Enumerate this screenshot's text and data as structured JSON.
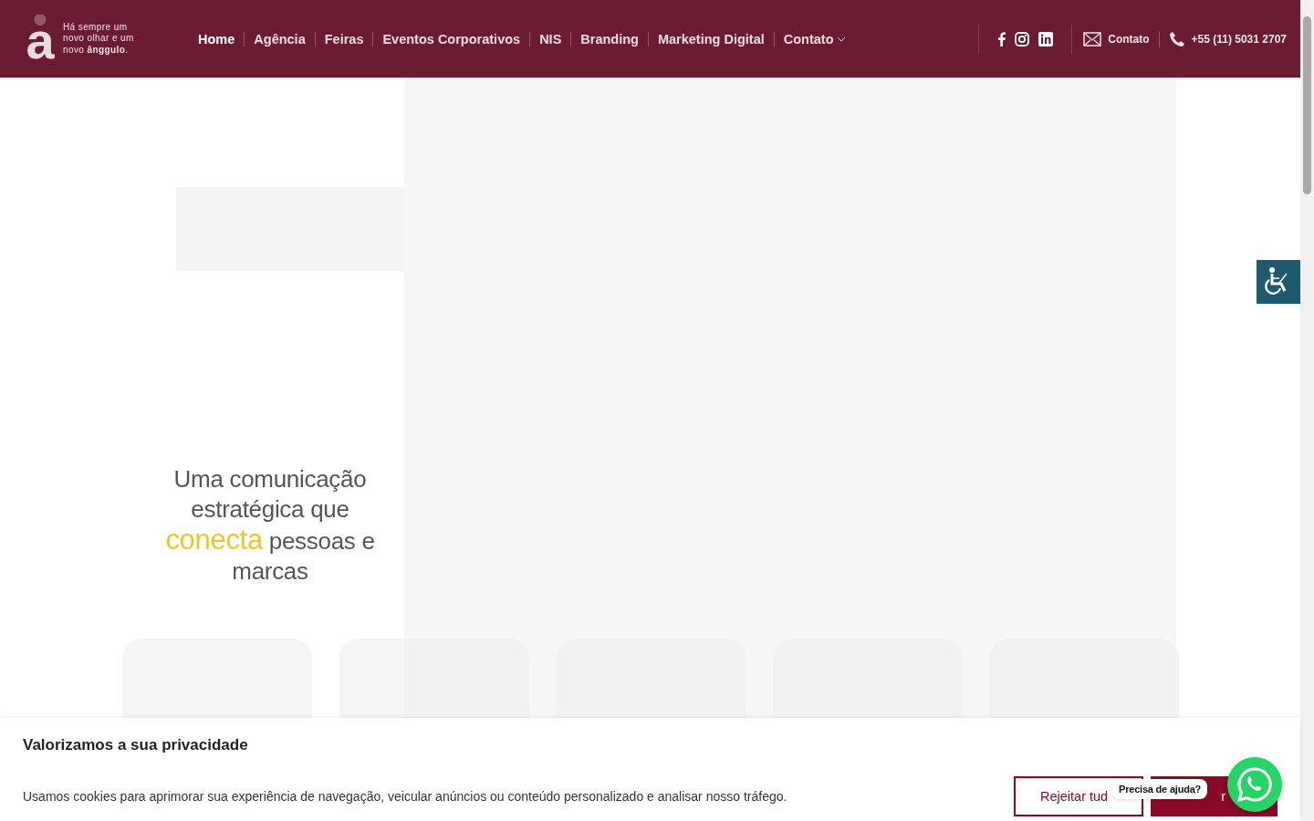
{
  "header": {
    "logo_mark": "a",
    "tagline": [
      "Há sempre um",
      "novo olhar e um",
      "novo **ânggulo**."
    ],
    "nav": [
      {
        "label": "Home",
        "selected": true,
        "dropdown": false
      },
      {
        "label": "Agência",
        "selected": false,
        "dropdown": false
      },
      {
        "label": "Feiras",
        "selected": false,
        "dropdown": false
      },
      {
        "label": "Eventos Corporativos",
        "selected": false,
        "dropdown": false
      },
      {
        "label": "NIS",
        "selected": false,
        "dropdown": false
      },
      {
        "label": "Branding",
        "selected": false,
        "dropdown": false
      },
      {
        "label": "Marketing Digital",
        "selected": false,
        "dropdown": false
      },
      {
        "label": "Contato",
        "selected": false,
        "dropdown": true
      }
    ],
    "contact_label": "Contato",
    "phone": "+55 (11) 5031 2707"
  },
  "hero": {
    "headline_before": "Uma comunicação estratégica que",
    "highlight": "conecta",
    "headline_after": "pessoas e marcas"
  },
  "cards": [
    {
      "kind": "placeholder"
    },
    {
      "kind": "placeholder"
    },
    {
      "kind": "placeholder"
    },
    {
      "kind": "placeholder"
    },
    {
      "kind": "placeholder"
    }
  ],
  "cookie_banner": {
    "title": "Valorizamos a sua privacidade",
    "text": "Usamos cookies para aprimorar sua experiência de navegação, veicular anúncios ou conteúdo personalizado e analisar nosso tráfego.",
    "reject_label": "Rejeitar tud",
    "accept_label": "r"
  },
  "chat": {
    "tooltip": "Precisa de ajuda?"
  }
}
